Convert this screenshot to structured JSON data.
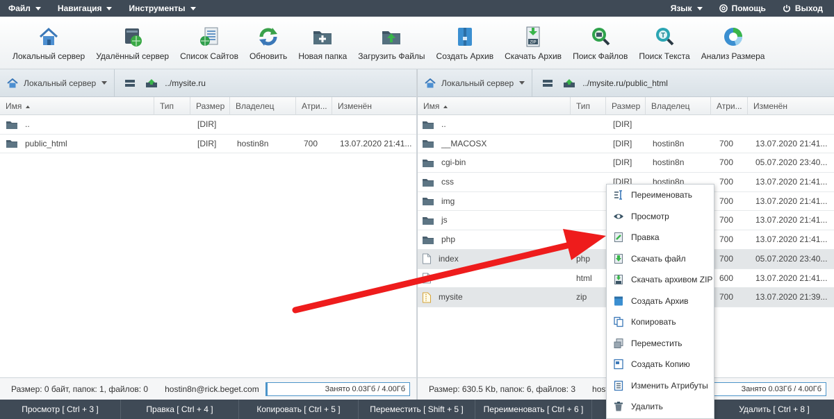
{
  "menubar": {
    "file": "Файл",
    "navigation": "Навигация",
    "tools": "Инструменты",
    "language": "Язык",
    "help": "Помощь",
    "logout": "Выход"
  },
  "toolbar": [
    {
      "label": "Локальный сервер",
      "icon": "home-server-icon"
    },
    {
      "label": "Удалённый сервер",
      "icon": "remote-server-icon"
    },
    {
      "label": "Список Сайтов",
      "icon": "sites-list-icon"
    },
    {
      "label": "Обновить",
      "icon": "refresh-icon"
    },
    {
      "label": "Новая папка",
      "icon": "new-folder-icon"
    },
    {
      "label": "Загрузить Файлы",
      "icon": "upload-icon"
    },
    {
      "label": "Создать Архив",
      "icon": "archive-icon"
    },
    {
      "label": "Скачать Архив",
      "icon": "download-archive-icon"
    },
    {
      "label": "Поиск Файлов",
      "icon": "search-files-icon"
    },
    {
      "label": "Поиск Текста",
      "icon": "search-text-icon"
    },
    {
      "label": "Анализ Размера",
      "icon": "size-analysis-icon"
    }
  ],
  "columns": {
    "name": "Имя",
    "type": "Тип",
    "size": "Размер",
    "owner": "Владелец",
    "attrs": "Атри...",
    "modified": "Изменён"
  },
  "left": {
    "server": "Локальный сервер",
    "path": "../mysite.ru",
    "rows": [
      {
        "name": "..",
        "type": "",
        "size": "[DIR]",
        "owner": "",
        "attrs": "",
        "modified": ""
      },
      {
        "name": "public_html",
        "type": "",
        "size": "[DIR]",
        "owner": "hostin8n",
        "attrs": "700",
        "modified": "13.07.2020 21:41..."
      }
    ],
    "status": "Размер: 0 байт, папок: 1, файлов: 0",
    "email": "hostin8n@rick.beget.com",
    "quota": "Занято 0.03Гб / 4.00Гб"
  },
  "right": {
    "server": "Локальный сервер",
    "path": "../mysite.ru/public_html",
    "rows": [
      {
        "name": "..",
        "type": "",
        "size": "[DIR]",
        "owner": "",
        "attrs": "",
        "modified": "",
        "kind": "folder"
      },
      {
        "name": "__MACOSX",
        "type": "",
        "size": "[DIR]",
        "owner": "hostin8n",
        "attrs": "700",
        "modified": "13.07.2020 21:41...",
        "kind": "folder"
      },
      {
        "name": "cgi-bin",
        "type": "",
        "size": "[DIR]",
        "owner": "hostin8n",
        "attrs": "700",
        "modified": "05.07.2020 23:40...",
        "kind": "folder"
      },
      {
        "name": "css",
        "type": "",
        "size": "[DIR]",
        "owner": "hostin8n",
        "attrs": "700",
        "modified": "13.07.2020 21:41...",
        "kind": "folder"
      },
      {
        "name": "img",
        "type": "",
        "size": "",
        "owner": "",
        "attrs": "700",
        "modified": "13.07.2020 21:41...",
        "kind": "folder"
      },
      {
        "name": "js",
        "type": "",
        "size": "",
        "owner": "",
        "attrs": "700",
        "modified": "13.07.2020 21:41...",
        "kind": "folder"
      },
      {
        "name": "php",
        "type": "",
        "size": "",
        "owner": "",
        "attrs": "700",
        "modified": "13.07.2020 21:41...",
        "kind": "folder"
      },
      {
        "name": "index",
        "type": "php",
        "size": "",
        "owner": "",
        "attrs": "700",
        "modified": "05.07.2020 23:40...",
        "kind": "file"
      },
      {
        "name": "",
        "type": "html",
        "size": "",
        "owner": "",
        "attrs": "600",
        "modified": "13.07.2020 21:41...",
        "kind": "file"
      },
      {
        "name": "mysite",
        "type": "zip",
        "size": "",
        "owner": "",
        "attrs": "700",
        "modified": "13.07.2020 21:39...",
        "kind": "zip"
      }
    ],
    "status": "Размер: 630.5 Kb, папок: 6, файлов: 3",
    "email_partial": "hosti",
    "quota": "Занято 0.03Гб / 4.00Гб"
  },
  "context_menu": [
    {
      "label": "Переименовать",
      "icon": "rename-icon"
    },
    {
      "label": "Просмотр",
      "icon": "eye-icon"
    },
    {
      "label": "Правка",
      "icon": "edit-icon"
    },
    {
      "label": "Скачать файл",
      "icon": "download-file-icon"
    },
    {
      "label": "Скачать архивом ZIP",
      "icon": "download-zip-icon"
    },
    {
      "label": "Создать Архив",
      "icon": "archive-icon"
    },
    {
      "label": "Копировать",
      "icon": "copy-icon"
    },
    {
      "label": "Переместить",
      "icon": "move-icon"
    },
    {
      "label": "Создать Копию",
      "icon": "duplicate-icon"
    },
    {
      "label": "Изменить Атрибуты",
      "icon": "attributes-icon"
    },
    {
      "label": "Удалить",
      "icon": "trash-icon"
    }
  ],
  "actionbar": [
    "Просмотр [ Ctrl + 3 ]",
    "Правка [ Ctrl + 4 ]",
    "Копировать [ Ctrl + 5 ]",
    "Переместить [ Shift + 5 ]",
    "Переименовать [ Ctrl + 6 ]",
    "",
    "Удалить [ Ctrl + 8 ]"
  ],
  "quota_used_fraction": 0.0075,
  "colors": {
    "bar": "#3f4a56",
    "accent": "#4b94c9",
    "arrow": "#ee1c1c"
  }
}
